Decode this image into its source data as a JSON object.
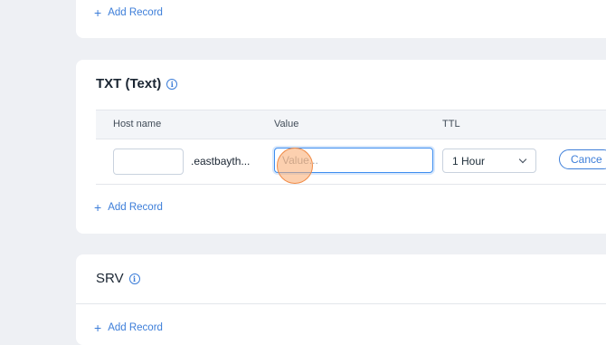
{
  "top_section": {
    "add_record_label": "Add Record"
  },
  "txt_section": {
    "title": "TXT (Text)",
    "columns": [
      "Host name",
      "Value",
      "TTL"
    ],
    "row": {
      "host_value": "",
      "domain_suffix": ".eastbayth...",
      "value_placeholder": "Value...",
      "value_value": "",
      "ttl_selected": "1 Hour",
      "cancel_label": "Cance"
    },
    "add_record_label": "Add Record"
  },
  "srv_section": {
    "title": "SRV",
    "add_record_label": "Add Record"
  },
  "colors": {
    "accent": "#3d7ed9",
    "focus_border": "#3d8ef0",
    "click_indicator": "#f08a45"
  },
  "icons": {
    "plus": "plus-icon",
    "info": "info-icon",
    "chevron": "chevron-down-icon"
  }
}
